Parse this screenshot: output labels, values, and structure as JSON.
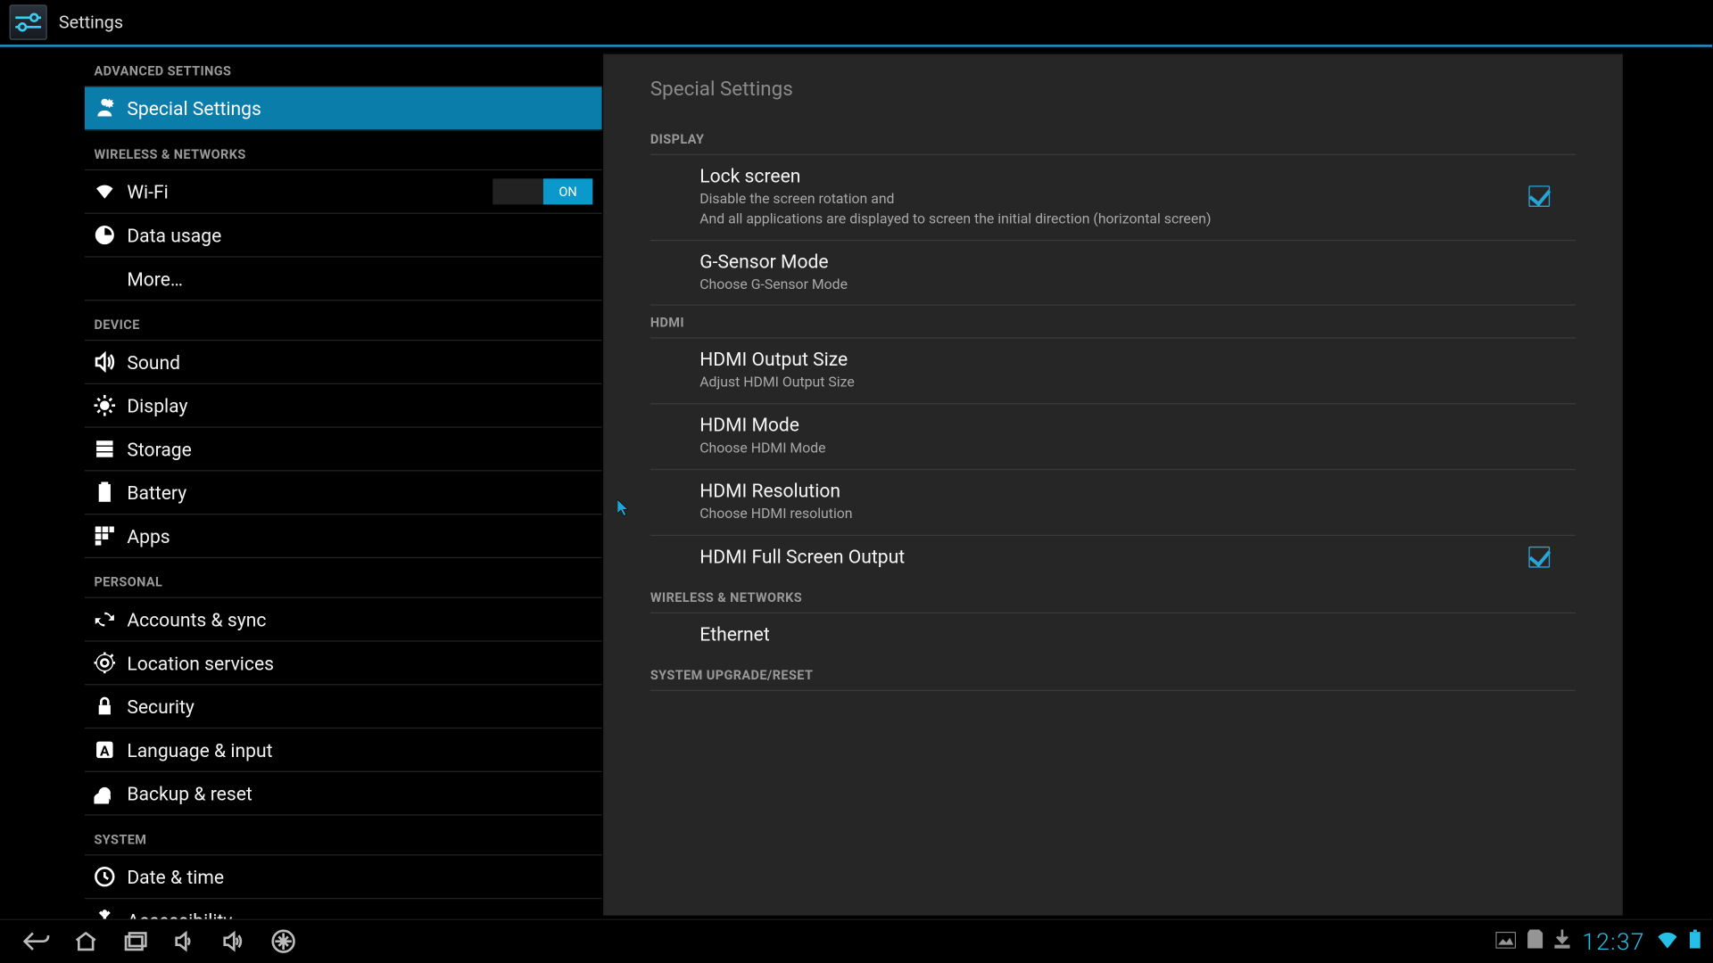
{
  "title": "Settings",
  "sidebar": {
    "sections": [
      {
        "header": "ADVANCED SETTINGS",
        "items": [
          {
            "icon": "special",
            "label": "Special Settings",
            "selected": true
          }
        ]
      },
      {
        "header": "WIRELESS & NETWORKS",
        "items": [
          {
            "icon": "wifi",
            "label": "Wi-Fi",
            "toggle": "ON"
          },
          {
            "icon": "data",
            "label": "Data usage"
          },
          {
            "icon": "none",
            "label": "More…"
          }
        ]
      },
      {
        "header": "DEVICE",
        "items": [
          {
            "icon": "sound",
            "label": "Sound"
          },
          {
            "icon": "display",
            "label": "Display"
          },
          {
            "icon": "storage",
            "label": "Storage"
          },
          {
            "icon": "battery",
            "label": "Battery"
          },
          {
            "icon": "apps",
            "label": "Apps"
          }
        ]
      },
      {
        "header": "PERSONAL",
        "items": [
          {
            "icon": "sync",
            "label": "Accounts & sync"
          },
          {
            "icon": "location",
            "label": "Location services"
          },
          {
            "icon": "security",
            "label": "Security"
          },
          {
            "icon": "lang",
            "label": "Language & input"
          },
          {
            "icon": "backup",
            "label": "Backup & reset"
          }
        ]
      },
      {
        "header": "SYSTEM",
        "items": [
          {
            "icon": "clock",
            "label": "Date & time"
          },
          {
            "icon": "access",
            "label": "Accessibility"
          }
        ]
      }
    ]
  },
  "pane": {
    "title": "Special Settings",
    "sections": [
      {
        "header": "DISPLAY",
        "rows": [
          {
            "title": "Lock screen",
            "sub": "Disable the screen rotation and\nAnd all applications are displayed to screen the initial direction (horizontal screen)",
            "check": true
          },
          {
            "title": "G-Sensor Mode",
            "sub": "Choose G-Sensor Mode"
          }
        ]
      },
      {
        "header": "HDMI",
        "rows": [
          {
            "title": "HDMI Output Size",
            "sub": "Adjust HDMI Output Size"
          },
          {
            "title": "HDMI Mode",
            "sub": "Choose HDMI Mode"
          },
          {
            "title": "HDMI Resolution",
            "sub": "Choose HDMI resolution"
          },
          {
            "title": "HDMI Full Screen Output",
            "check": true,
            "last": true
          }
        ]
      },
      {
        "header": "WIRELESS & NETWORKS",
        "rows": [
          {
            "title": "Ethernet",
            "last": true
          }
        ]
      },
      {
        "header": "SYSTEM UPGRADE/RESET",
        "rows": []
      }
    ]
  },
  "statusbar": {
    "clock": "12:37"
  }
}
